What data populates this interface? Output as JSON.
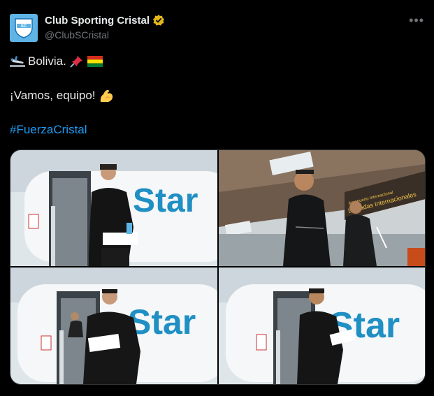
{
  "account": {
    "display_name": "Club Sporting Cristal",
    "handle": "@ClubSCristal",
    "verified": true,
    "avatar_text": "SC",
    "colors": {
      "avatar_bg": "#5fb4e6",
      "verified_badge": "#e2b719"
    }
  },
  "post": {
    "line1_text": "Bolivia.",
    "line2_text": "¡Vamos, equipo!",
    "hashtag": "#FuerzaCristal",
    "emojis": [
      "airplane-landing",
      "pushpin",
      "bolivia-flag",
      "flexed-biceps"
    ]
  },
  "menu": {
    "more_label": "•••"
  },
  "media": {
    "photos": [
      {
        "subject": "player-descending-airplane-stairs",
        "airline_text": "Star"
      },
      {
        "subject": "staff-walking-under-airport-canopy",
        "sign_text": "Llegadas Internacionales",
        "sign_subtext": "Aeropuerto Internacional"
      },
      {
        "subject": "player-descending-airplane-stairs",
        "airline_text": "Star"
      },
      {
        "subject": "player-descending-airplane-stairs",
        "airline_text": "Star"
      }
    ]
  },
  "colors": {
    "background": "#000000",
    "text": "#e7e9ea",
    "secondary_text": "#71767b",
    "link": "#1d9bf0",
    "airline_blue": "#1f8fc4"
  }
}
